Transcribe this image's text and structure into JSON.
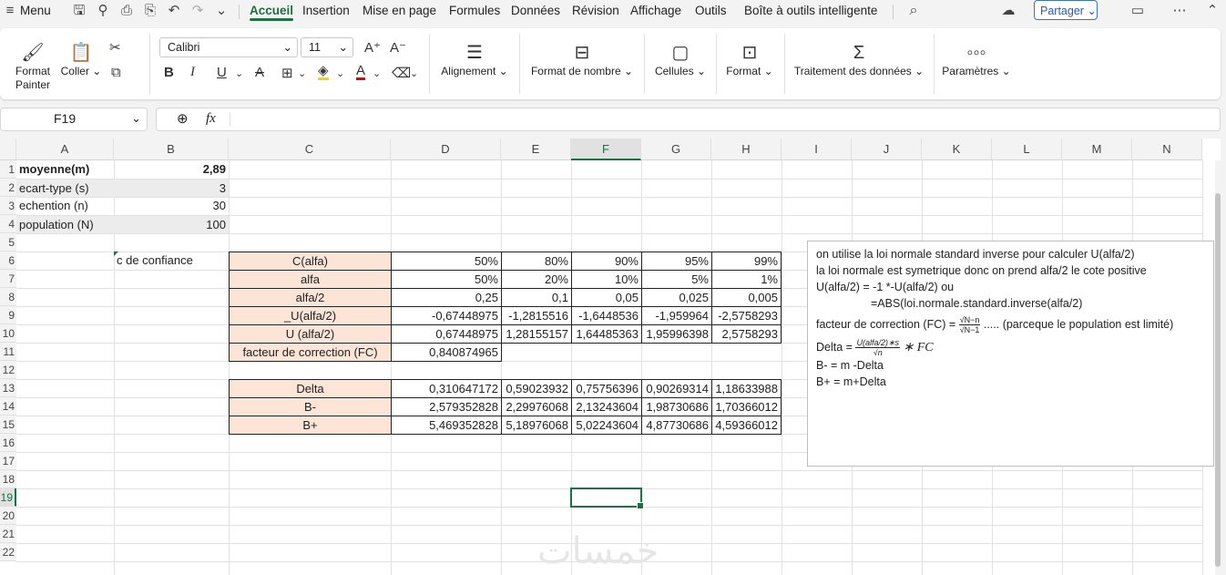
{
  "menu": {
    "hamburger_label": "Menu",
    "tabs": [
      "Accueil",
      "Insertion",
      "Mise en page",
      "Formules",
      "Données",
      "Révision",
      "Affichage",
      "Outils",
      "Boîte à outils intelligente"
    ],
    "share_label": "Partager"
  },
  "ribbon": {
    "format_painter": "Format Painter",
    "paste": "Coller",
    "font_name": "Calibri",
    "font_size": "11",
    "alignment": "Alignement",
    "number_format": "Format de nombre",
    "cells": "Cellules",
    "format": "Format",
    "data_processing": "Traitement des données",
    "settings": "Paramètres"
  },
  "formula_bar": {
    "name_box": "F19",
    "fx": "fx",
    "content": ""
  },
  "columns": [
    "A",
    "B",
    "C",
    "D",
    "E",
    "F",
    "G",
    "H",
    "I",
    "J",
    "K",
    "L",
    "M",
    "N"
  ],
  "rows": [
    "1",
    "2",
    "3",
    "4",
    "5",
    "6",
    "7",
    "8",
    "9",
    "10",
    "11",
    "12",
    "13",
    "14",
    "15",
    "16",
    "17",
    "18",
    "19",
    "20",
    "21",
    "22"
  ],
  "cells": {
    "A1": "moyenne(m)",
    "B1": "2,89",
    "A2": "ecart-type (s)",
    "B2": "3",
    "A3": "echention (n)",
    "B3": "30",
    "A4": "population (N)",
    "B4": "100",
    "B6": "c de confiance",
    "C6": "C(alfa)",
    "D6": "50%",
    "E6": "80%",
    "F6": "90%",
    "G6": "95%",
    "H6": "99%",
    "C7": "alfa",
    "D7": "50%",
    "E7": "20%",
    "F7": "10%",
    "G7": "5%",
    "H7": "1%",
    "C8": "alfa/2",
    "D8": "0,25",
    "E8": "0,1",
    "F8": "0,05",
    "G8": "0,025",
    "H8": "0,005",
    "C9": "_U(alfa/2)",
    "D9": "-0,67448975",
    "E9": "-1,2815516",
    "F9": "-1,6448536",
    "G9": "-1,959964",
    "H9": "-2,5758293",
    "C10": "U (alfa/2)",
    "D10": "0,67448975",
    "E10": "1,28155157",
    "F10": "1,64485363",
    "G10": "1,95996398",
    "H10": "2,5758293",
    "C11": "facteur de correction (FC)",
    "D11": "0,840874965",
    "C13": "Delta",
    "D13": "0,310647172",
    "E13": "0,59023932",
    "F13": "0,75756396",
    "G13": "0,90269314",
    "H13": "1,18633988",
    "C14": "B-",
    "D14": "2,579352828",
    "E14": "2,29976068",
    "F14": "2,13243604",
    "G14": "1,98730686",
    "H14": "1,70366012",
    "C15": "B+",
    "D15": "5,469352828",
    "E15": "5,18976068",
    "F15": "5,02243604",
    "G15": "4,87730686",
    "H15": "4,59366012"
  },
  "textbox": {
    "line1": "on utilise la loi normale standard inverse pour calculer U(alfa/2)",
    "line2": "la loi normale est symetrique donc on prend alfa/2 le cote positive",
    "line3": "U(alfa/2) = -1 *-U(alfa/2) ou",
    "line4": "=ABS(loi.normale.standard.inverse(alfa/2)",
    "fc_label": "facteur de correction (FC) =",
    "fc_num": "√N−n",
    "fc_den": "√N−1",
    "fc_note": "..... (parceque le population est limité)",
    "delta_label": "Delta =",
    "delta_num": "U(alfa/2)∗s",
    "delta_den": "√n",
    "delta_tail": "∗ FC",
    "line7": "B- = m -Delta",
    "line8": "B+ = m+Delta"
  },
  "watermark": "خمسات"
}
